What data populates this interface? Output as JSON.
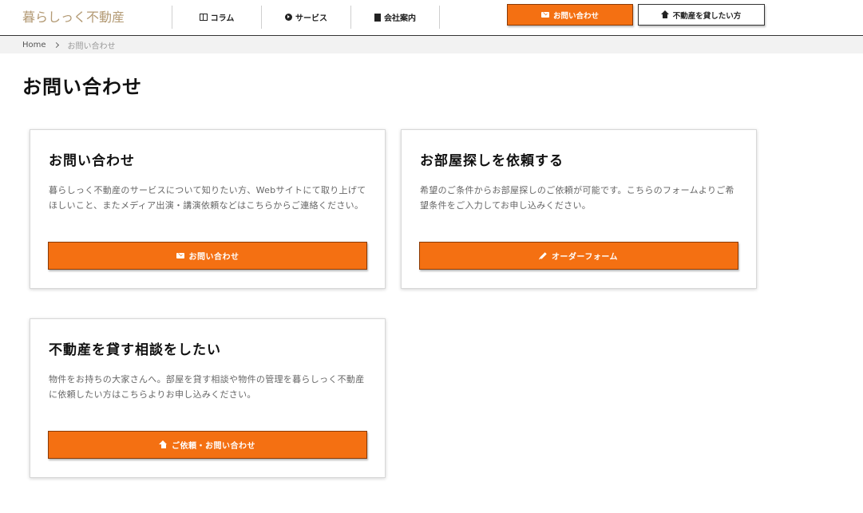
{
  "header": {
    "logo": "暮らしっく不動産",
    "nav": [
      {
        "label": "コラム",
        "icon": "column-icon"
      },
      {
        "label": "サービス",
        "icon": "chevron-circle-icon"
      },
      {
        "label": "会社案内",
        "icon": "building-icon"
      }
    ],
    "contact_button": "お問い合わせ",
    "rent_button": "不動産を貸したい方"
  },
  "breadcrumb": {
    "home": "Home",
    "current": "お問い合わせ"
  },
  "page": {
    "title": "お問い合わせ"
  },
  "cards": [
    {
      "title": "お問い合わせ",
      "description": "暮らしっく不動産のサービスについて知りたい方、Webサイトにて取り上げてほしいこと、またメディア出演・講演依頼などはこちらからご連絡ください。",
      "button": "お問い合わせ",
      "icon": "mail-icon"
    },
    {
      "title": "お部屋探しを依頼する",
      "description": "希望のご条件からお部屋探しのご依頼が可能です。こちらのフォームよりご希望条件をご入力してお申し込みください。",
      "button": "オーダーフォーム",
      "icon": "pencil-icon"
    },
    {
      "title": "不動産を貸す相談をしたい",
      "description": "物件をお持ちの大家さんへ。部屋を貸す相談や物件の管理を暮らしっく不動産に依頼したい方はこちらよりお申し込みください。",
      "button": "ご依頼・お問い合わせ",
      "icon": "home-icon"
    }
  ],
  "colors": {
    "accent": "#f47012",
    "logo": "#b39a74",
    "breadcrumb_bg": "#f2f2f2"
  }
}
